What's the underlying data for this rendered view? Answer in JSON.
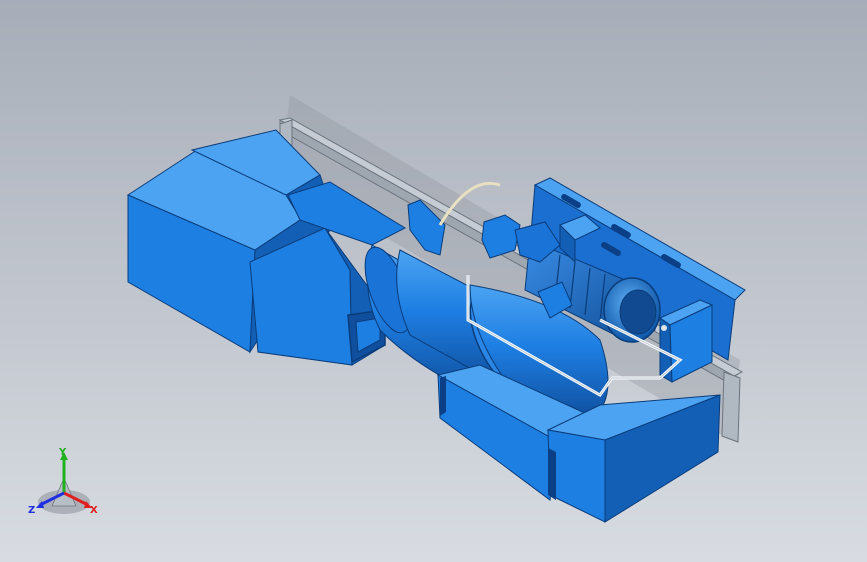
{
  "viewport": {
    "background_top": "#a7adb8",
    "background_bottom": "#d8dce2"
  },
  "model": {
    "body_color": "#1e7fe3",
    "shade_color": "#135fb5",
    "light_color": "#4ca3f2",
    "frame_color": "#b8c0c8",
    "cable_color": "#e8e0c0",
    "icons": [
      "fan-housing-icon",
      "motor-icon",
      "duct-icon"
    ]
  },
  "triad": {
    "x_label": "X",
    "y_label": "Y",
    "z_label": "Z",
    "x_color": "#e02020",
    "y_color": "#20b020",
    "z_color": "#2030e0"
  }
}
